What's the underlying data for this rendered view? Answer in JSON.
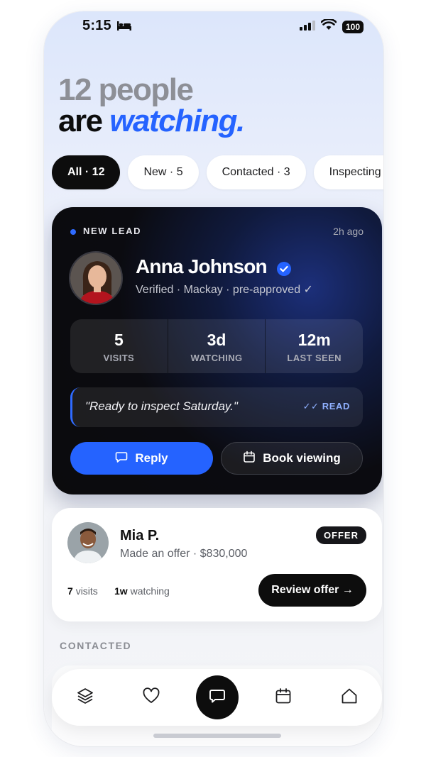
{
  "status_bar": {
    "time": "5:15",
    "battery": "100"
  },
  "hero": {
    "line1": "12 people",
    "line2_plain": "are ",
    "line2_accent": "watching."
  },
  "filters": [
    {
      "label": "All · 12",
      "active": true
    },
    {
      "label": "New · 5",
      "active": false
    },
    {
      "label": "Contacted · 3",
      "active": false
    },
    {
      "label": "Inspecting ·",
      "active": false
    }
  ],
  "lead_card": {
    "tag": "NEW LEAD",
    "time_ago": "2h ago",
    "name": "Anna Johnson",
    "subtitle": "Verified · Mackay · pre-approved ✓",
    "stats": [
      {
        "value": "5",
        "label": "VISITS"
      },
      {
        "value": "3d",
        "label": "WATCHING"
      },
      {
        "value": "12m",
        "label": "LAST SEEN"
      }
    ],
    "quote": "\"Ready to inspect Saturday.\"",
    "read_status": "✓✓ READ",
    "reply_label": "Reply",
    "book_label": "Book viewing"
  },
  "offer_card": {
    "name": "Mia P.",
    "subtitle": "Made an offer · $830,000",
    "badge": "OFFER",
    "visits_count": "7",
    "visits_label": "visits",
    "watch_count": "1w",
    "watch_label": "watching",
    "review_label": "Review offer →"
  },
  "section_label": "CONTACTED",
  "tab_bar": {
    "items": [
      "layers-icon",
      "heart-icon",
      "chat-icon",
      "calendar-icon",
      "home-icon"
    ]
  },
  "colors": {
    "accent": "#2563ff",
    "dark": "#0d0d0d"
  }
}
